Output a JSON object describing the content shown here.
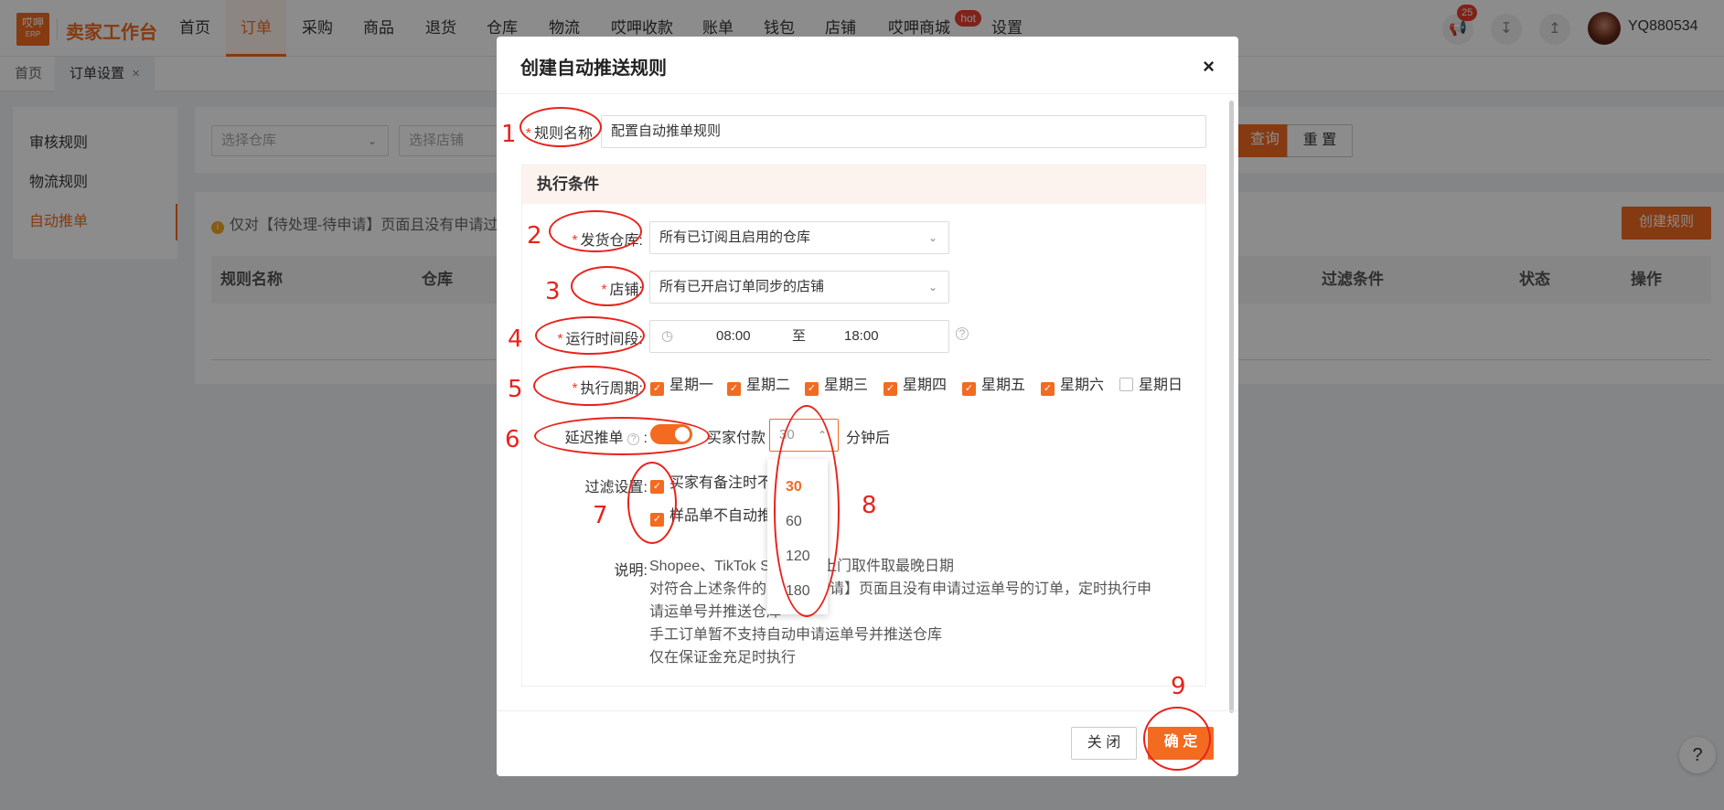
{
  "app": {
    "logo_text": "哎呷",
    "logo_sub": "ERP",
    "brand": "卖家工作台",
    "nav": [
      "首页",
      "订单",
      "采购",
      "商品",
      "退货",
      "仓库",
      "物流",
      "哎呷收款",
      "账单",
      "钱包",
      "店铺",
      "哎呷商城",
      "设置"
    ],
    "hot_badge": "hot",
    "notification_count": "25",
    "username": "YQ880534"
  },
  "tabs": {
    "home": "首页",
    "current": "订单设置",
    "close": "×"
  },
  "sidebar": {
    "items": [
      "审核规则",
      "物流规则",
      "自动推单"
    ]
  },
  "filters": {
    "warehouse_placeholder": "选择仓库",
    "store_placeholder": "选择店铺",
    "query_label": "查询",
    "reset_label": "重 置",
    "create_label": "创建规则"
  },
  "notice": "仅对【待处理-待申请】页面且没有申请过",
  "table_headers": [
    "规则名称",
    "仓库",
    "过滤条件",
    "状态",
    "操作"
  ],
  "modal": {
    "title": "创建自动推送规则",
    "close": "×",
    "rule_name_label": "规则名称",
    "rule_name_value": "配置自动推单规则",
    "section_title": "执行条件",
    "warehouse_label": "发货仓库:",
    "warehouse_value": "所有已订阅且启用的仓库",
    "store_label": "店铺:",
    "store_value": "所有已开启订单同步的店铺",
    "runtime_label": "运行时间段:",
    "time_start": "08:00",
    "time_to": "至",
    "time_end": "18:00",
    "cycle_label": "执行周期:",
    "days": [
      {
        "label": "星期一",
        "checked": true
      },
      {
        "label": "星期二",
        "checked": true
      },
      {
        "label": "星期三",
        "checked": true
      },
      {
        "label": "星期四",
        "checked": true
      },
      {
        "label": "星期五",
        "checked": true
      },
      {
        "label": "星期六",
        "checked": true
      },
      {
        "label": "星期日",
        "checked": false
      }
    ],
    "delay_label": "延迟推单",
    "delay_colon": ":",
    "buyer_pay": "买家付款",
    "delay_value": "30",
    "delay_unit": "分钟后",
    "delay_options": [
      "30",
      "60",
      "120",
      "180"
    ],
    "filter_label": "过滤设置:",
    "filter_opts": [
      "买家有备注时不",
      "样品单不自动推"
    ],
    "notes_label": "说明:",
    "notes": [
      "Shopee、TikTok S",
      "上门取件取最晚日期",
      "对符合上述条件的",
      "申请】页面且没有申请过运单号的订单，定时执行申",
      "请运单号并推送仓库",
      "手工订单暂不支持自动申请运单号并推送仓库",
      "仅在保证金充足时执行"
    ],
    "cancel_label": "关 闭",
    "confirm_label": "确 定"
  },
  "annotations": [
    "1",
    "2",
    "3",
    "4",
    "5",
    "6",
    "7",
    "8",
    "9"
  ],
  "help": "?",
  "colors": {
    "accent": "#f26b21",
    "annotation": "#e8231c"
  }
}
